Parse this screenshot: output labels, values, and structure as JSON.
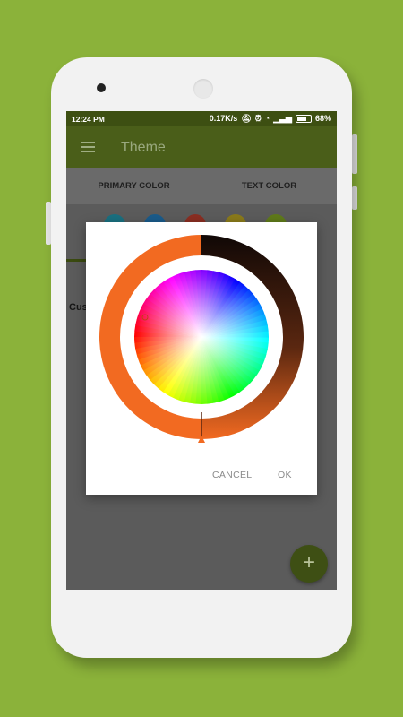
{
  "status_bar": {
    "time": "12:24 PM",
    "net_speed": "0.17K/s",
    "battery": "68%"
  },
  "app_bar": {
    "title": "Theme",
    "menu_icon": "menu-icon"
  },
  "tabs": [
    {
      "label": "PRIMARY COLOR",
      "selected": true
    },
    {
      "label": "TEXT COLOR",
      "selected": false
    }
  ],
  "content": {
    "custom_label": "Cus",
    "swatches": [
      "#1a6f7f",
      "#1a5b8a",
      "#8a2e22",
      "#8a7a1a",
      "#5f7a1a"
    ]
  },
  "dialog": {
    "cancel_label": "CANCEL",
    "ok_label": "OK",
    "selected_color": "#f26a21",
    "colors": {
      "ring_left": "#f26a21",
      "ring_dark": "#100806"
    }
  },
  "fab": {
    "icon": "plus-icon",
    "label": "+"
  },
  "colors": {
    "background": "#8bb23a",
    "app_bar": "#4a5e19",
    "status_bar": "#3d4f12"
  }
}
